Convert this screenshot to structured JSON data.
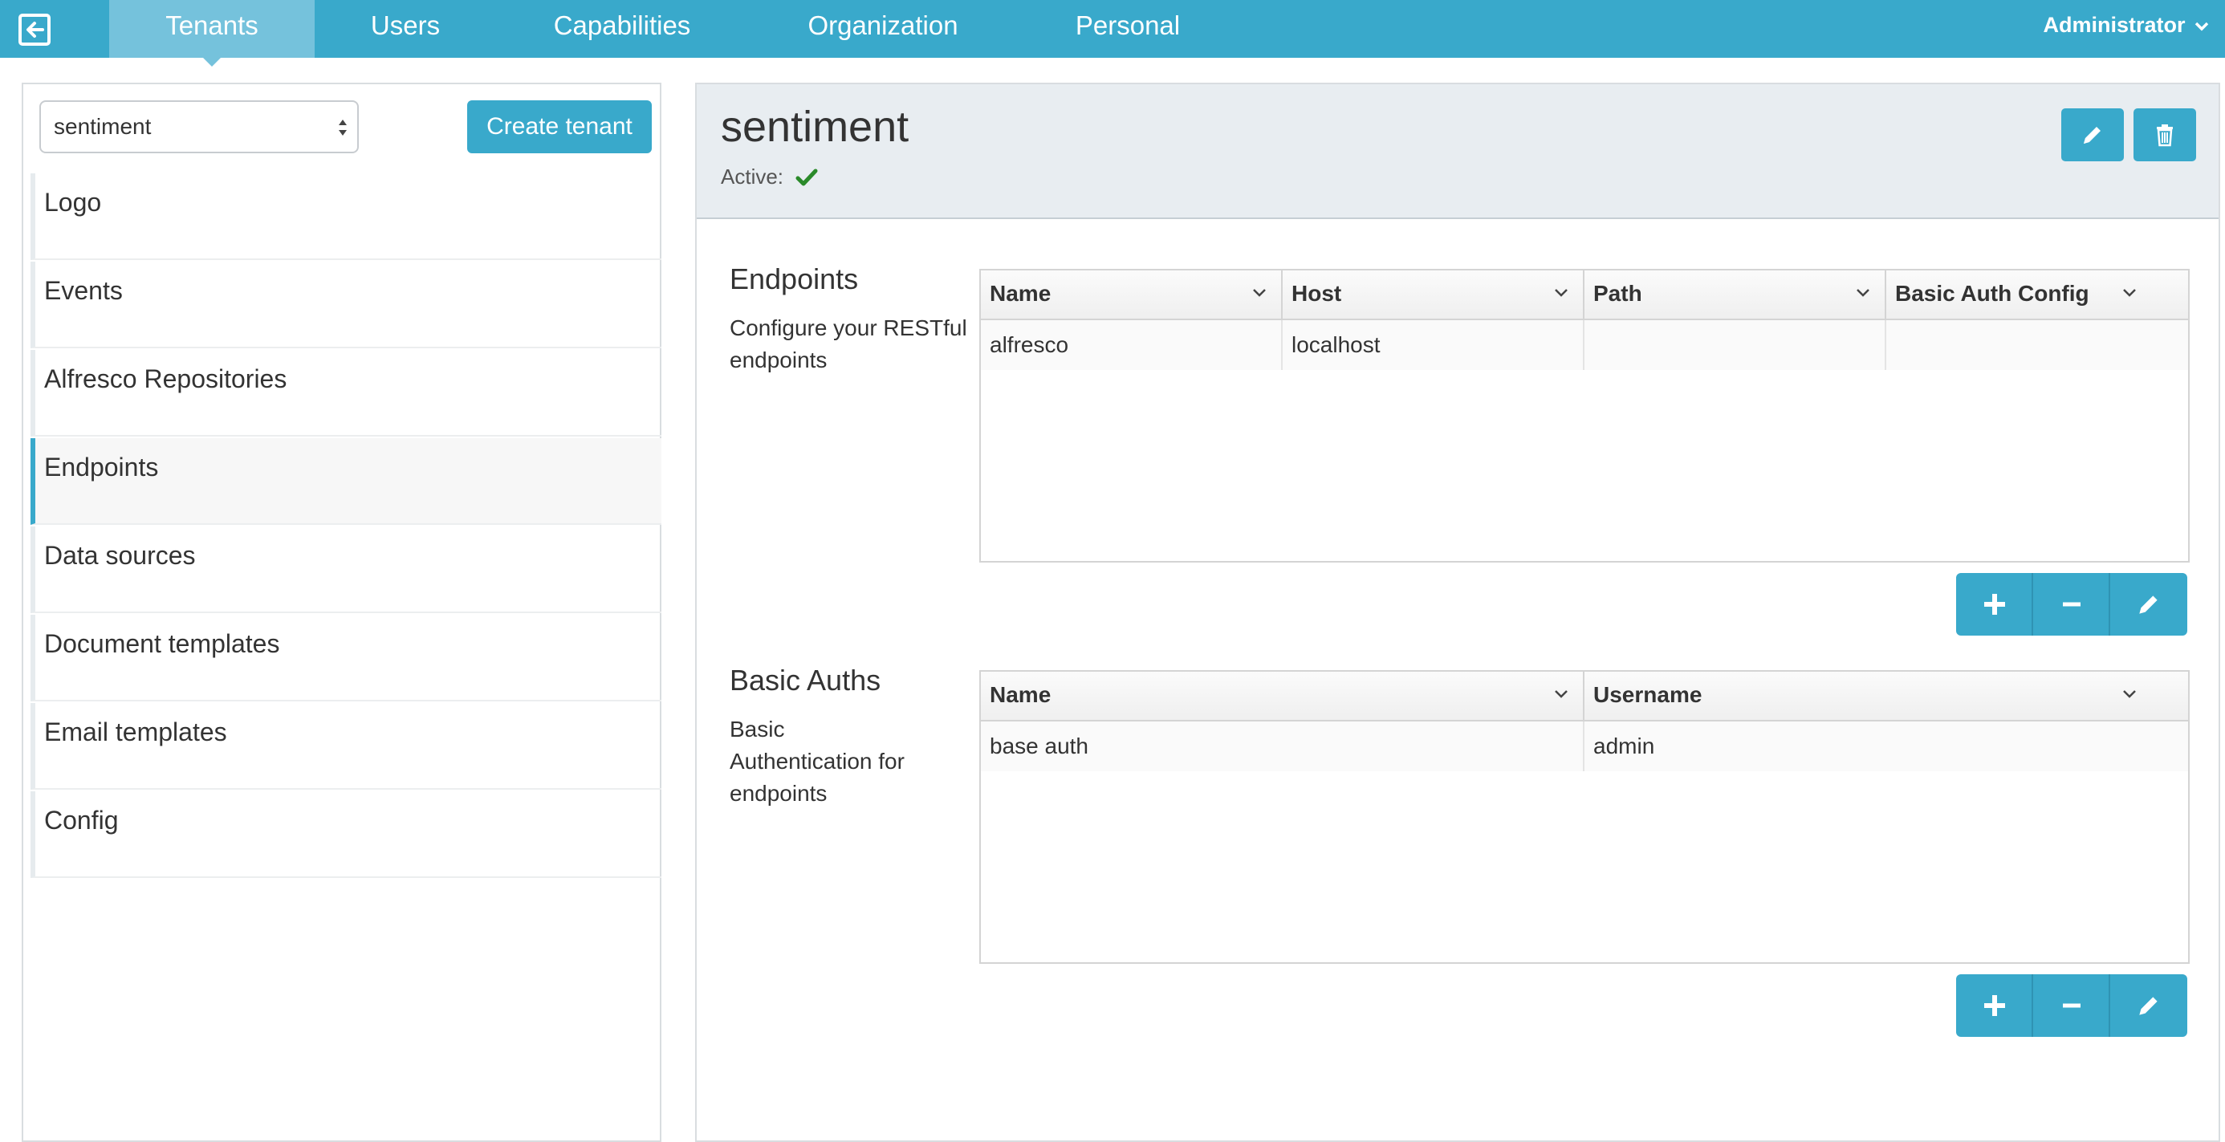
{
  "nav": {
    "tabs": [
      {
        "label": "Tenants",
        "active": true
      },
      {
        "label": "Users"
      },
      {
        "label": "Capabilities"
      },
      {
        "label": "Organization"
      },
      {
        "label": "Personal"
      }
    ],
    "user_menu": "Administrator",
    "logout_icon": "logout-icon"
  },
  "sidebar": {
    "tenant_select_value": "sentiment",
    "create_button": "Create tenant",
    "items": [
      {
        "label": "Logo"
      },
      {
        "label": "Events"
      },
      {
        "label": "Alfresco Repositories"
      },
      {
        "label": "Endpoints",
        "active": true
      },
      {
        "label": "Data sources"
      },
      {
        "label": "Document templates"
      },
      {
        "label": "Email templates"
      },
      {
        "label": "Config"
      }
    ]
  },
  "tenant": {
    "name": "sentiment",
    "active_label": "Active:",
    "active": true
  },
  "endpoints": {
    "title": "Endpoints",
    "description": "Configure your RESTful endpoints",
    "columns": [
      "Name",
      "Host",
      "Path",
      "Basic Auth Config"
    ],
    "rows": [
      [
        "alfresco",
        "localhost",
        "",
        ""
      ]
    ]
  },
  "basic_auths": {
    "title": "Basic Auths",
    "description": "Basic Authentication for endpoints",
    "columns": [
      "Name",
      "Username"
    ],
    "rows": [
      [
        "base auth",
        "admin"
      ]
    ]
  },
  "colors": {
    "accent": "#39a9cb",
    "active_tab": "#75c2dc",
    "check_green": "#2a8a2a"
  }
}
